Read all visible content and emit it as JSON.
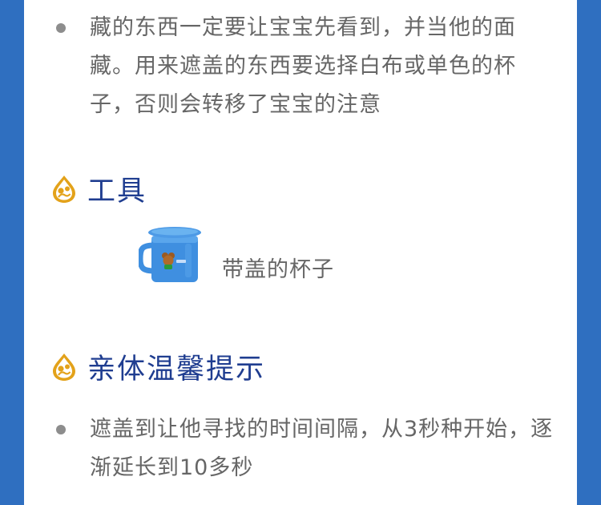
{
  "bullets": {
    "first": "藏的东西一定要让宝宝先看到，并当他的面藏。用来遮盖的东西要选择白布或单色的杯子，否则会转移了宝宝的注意",
    "second": "遮盖到让他寻找的时间间隔，从3秒种开始，逐渐延长到10多秒"
  },
  "sections": {
    "tools_title": "工具",
    "tips_title": "亲体温馨提示"
  },
  "tool": {
    "label": "带盖的杯子"
  },
  "colors": {
    "frame": "#2f6fc0",
    "heading": "#1f3d90",
    "text": "#666666",
    "logo_gold": "#e3a21a",
    "cup_blue": "#3f8fe0"
  }
}
